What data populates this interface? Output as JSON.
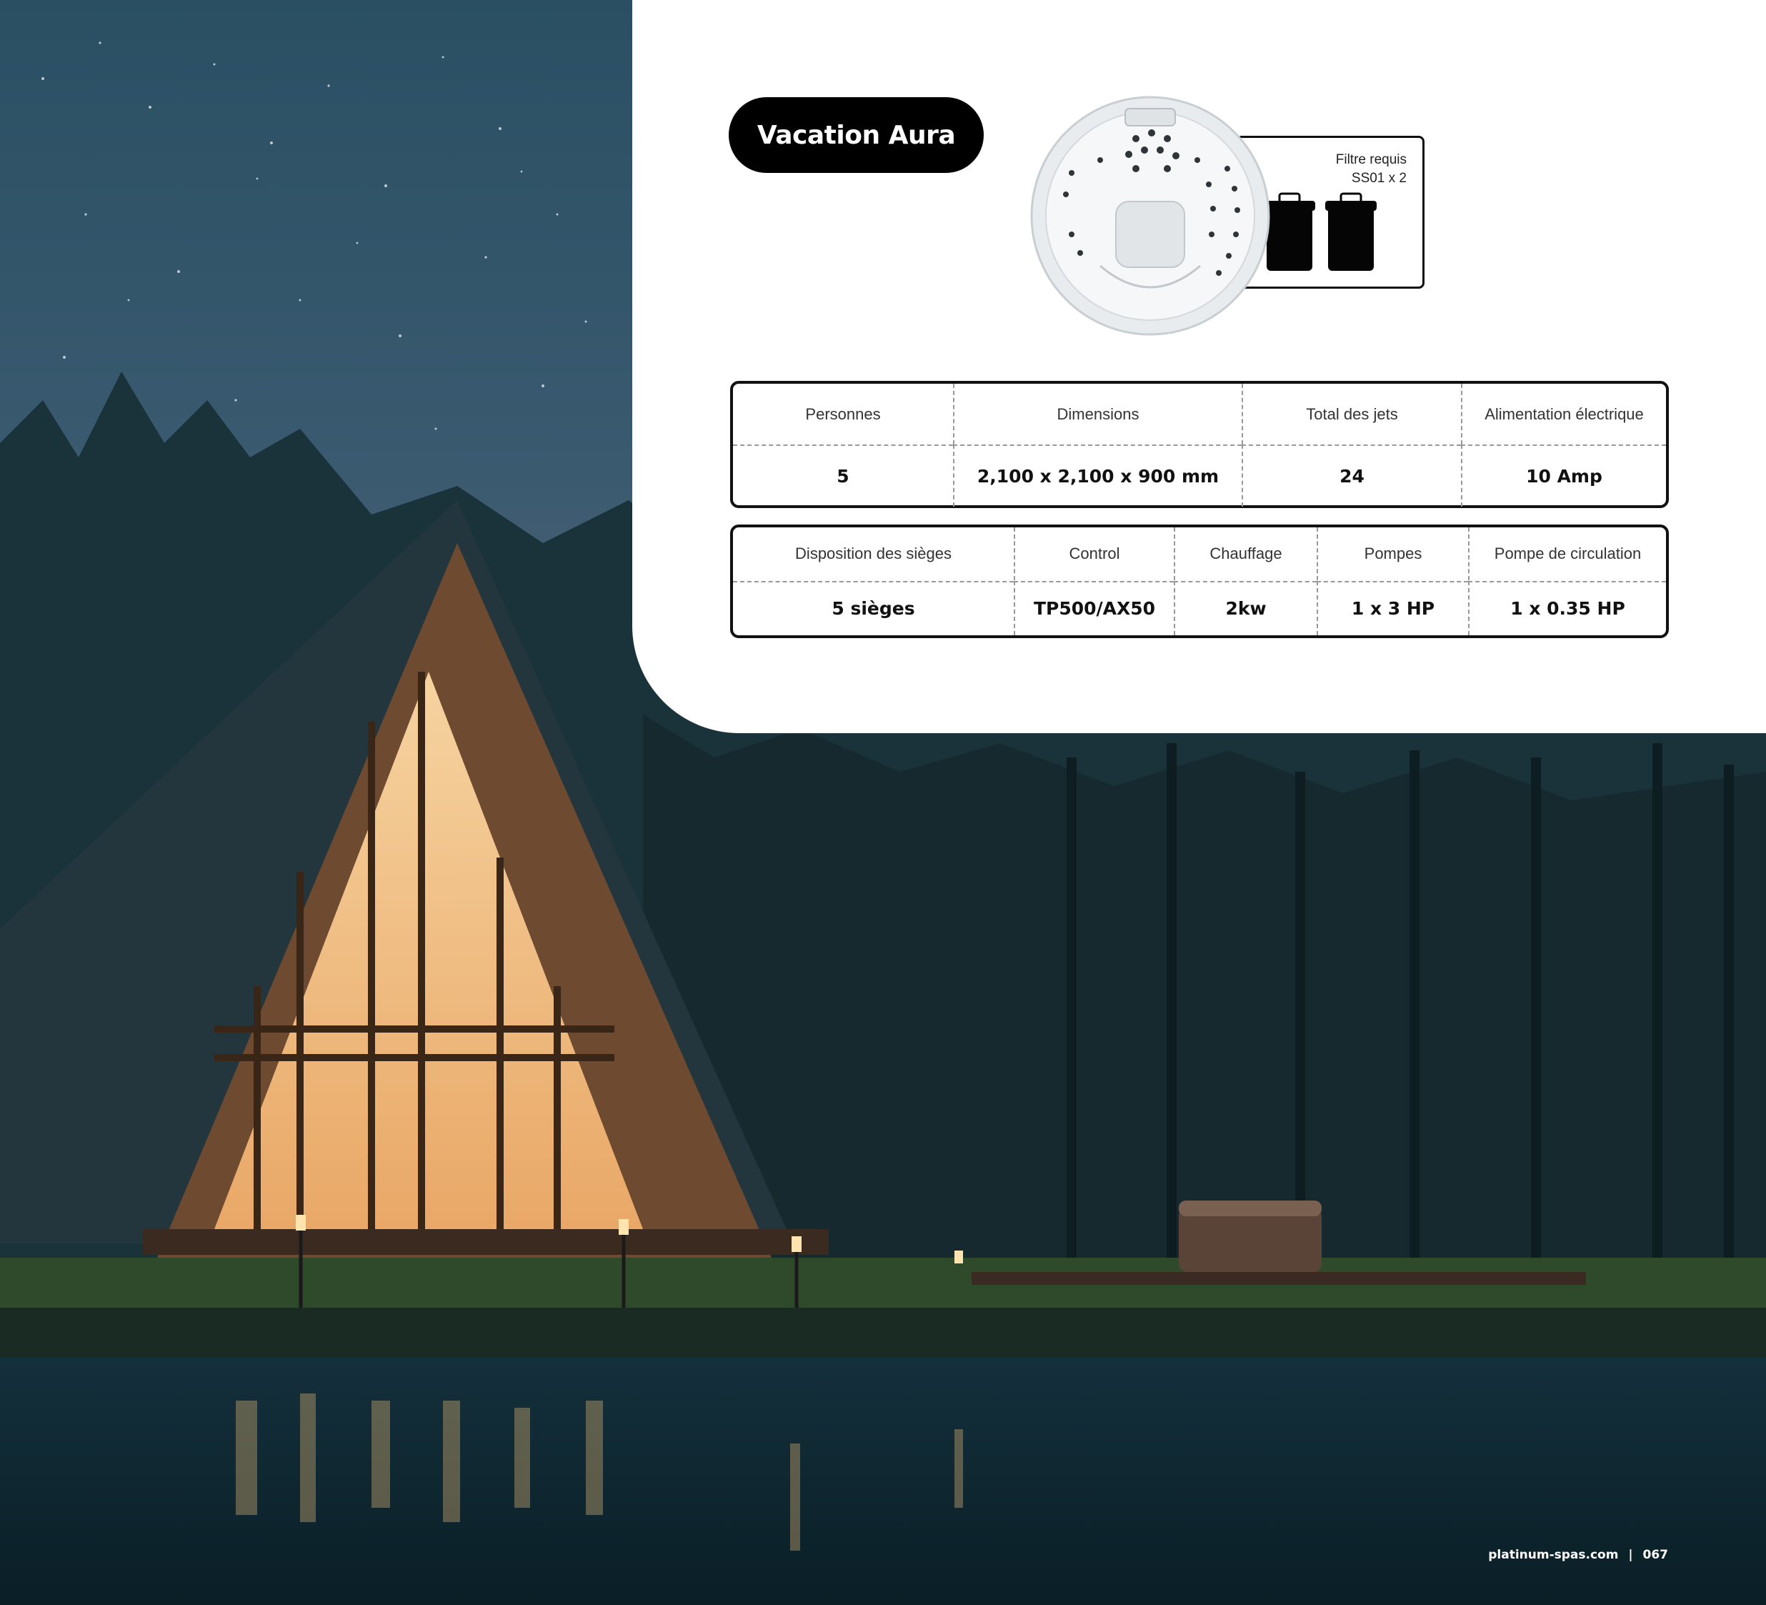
{
  "product": {
    "name": "Vacation Aura"
  },
  "filter": {
    "label": "Filtre requis",
    "model": "SS01 x 2"
  },
  "specs_1": {
    "headers": [
      "Personnes",
      "Dimensions",
      "Total des jets",
      "Alimentation électrique"
    ],
    "values": [
      "5",
      "2,100 x 2,100 x 900 mm",
      "24",
      "10 Amp"
    ]
  },
  "specs_2": {
    "headers": [
      "Disposition des sièges",
      "Control",
      "Chauffage",
      "Pompes",
      "Pompe de circulation"
    ],
    "values": [
      "5 sièges",
      "TP500/AX50",
      "2kw",
      "1 x 3 HP",
      "1 x 0.35 HP"
    ]
  },
  "footer": {
    "site": "platinum-spas.com",
    "separator": "|",
    "page": "067"
  },
  "colors": {
    "panel": "#ffffff",
    "pill": "#000000",
    "night_sky": "#1f4658",
    "cabin_glow": "#f4c58a"
  }
}
